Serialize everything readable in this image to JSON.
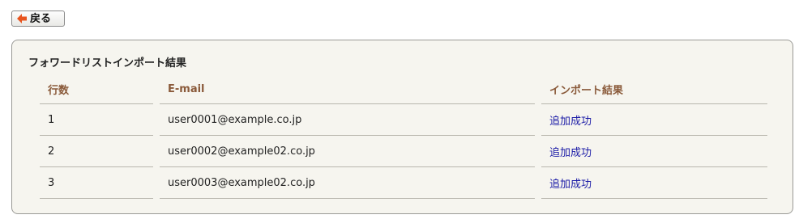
{
  "toolbar": {
    "back_label": "戻る",
    "back_icon": "arrow-left-icon",
    "back_icon_color": "#e8541e"
  },
  "panel": {
    "title": "フォワードリストインポート結果"
  },
  "table": {
    "headers": [
      "行数",
      "E-mail",
      "インポート結果"
    ],
    "rows": [
      {
        "num": "1",
        "email": "user0001@example.co.jp",
        "result": "追加成功"
      },
      {
        "num": "2",
        "email": "user0002@example02.co.jp",
        "result": "追加成功"
      },
      {
        "num": "3",
        "email": "user0003@example02.co.jp",
        "result": "追加成功"
      }
    ]
  },
  "colors": {
    "header_text": "#8a5a3a",
    "link": "#1a1aa6",
    "panel_bg": "#f6f5ef"
  }
}
